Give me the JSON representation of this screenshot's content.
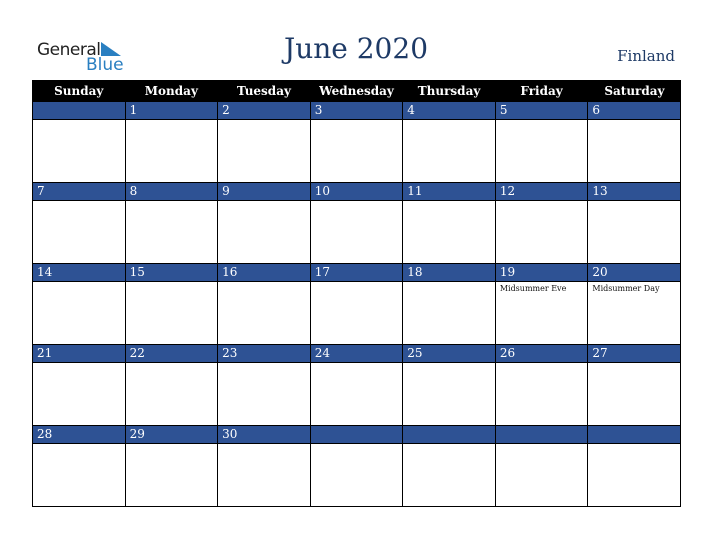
{
  "logo": {
    "general": "General",
    "blue": "Blue"
  },
  "title": "June 2020",
  "country": "Finland",
  "weekdays": [
    "Sunday",
    "Monday",
    "Tuesday",
    "Wednesday",
    "Thursday",
    "Friday",
    "Saturday"
  ],
  "weeks": [
    [
      {
        "d": "",
        "h": ""
      },
      {
        "d": "1",
        "h": ""
      },
      {
        "d": "2",
        "h": ""
      },
      {
        "d": "3",
        "h": ""
      },
      {
        "d": "4",
        "h": ""
      },
      {
        "d": "5",
        "h": ""
      },
      {
        "d": "6",
        "h": ""
      }
    ],
    [
      {
        "d": "7",
        "h": ""
      },
      {
        "d": "8",
        "h": ""
      },
      {
        "d": "9",
        "h": ""
      },
      {
        "d": "10",
        "h": ""
      },
      {
        "d": "11",
        "h": ""
      },
      {
        "d": "12",
        "h": ""
      },
      {
        "d": "13",
        "h": ""
      }
    ],
    [
      {
        "d": "14",
        "h": ""
      },
      {
        "d": "15",
        "h": ""
      },
      {
        "d": "16",
        "h": ""
      },
      {
        "d": "17",
        "h": ""
      },
      {
        "d": "18",
        "h": ""
      },
      {
        "d": "19",
        "h": "Midsummer Eve"
      },
      {
        "d": "20",
        "h": "Midsummer Day"
      }
    ],
    [
      {
        "d": "21",
        "h": ""
      },
      {
        "d": "22",
        "h": ""
      },
      {
        "d": "23",
        "h": ""
      },
      {
        "d": "24",
        "h": ""
      },
      {
        "d": "25",
        "h": ""
      },
      {
        "d": "26",
        "h": ""
      },
      {
        "d": "27",
        "h": ""
      }
    ],
    [
      {
        "d": "28",
        "h": ""
      },
      {
        "d": "29",
        "h": ""
      },
      {
        "d": "30",
        "h": ""
      },
      {
        "d": "",
        "h": ""
      },
      {
        "d": "",
        "h": ""
      },
      {
        "d": "",
        "h": ""
      },
      {
        "d": "",
        "h": ""
      }
    ]
  ]
}
